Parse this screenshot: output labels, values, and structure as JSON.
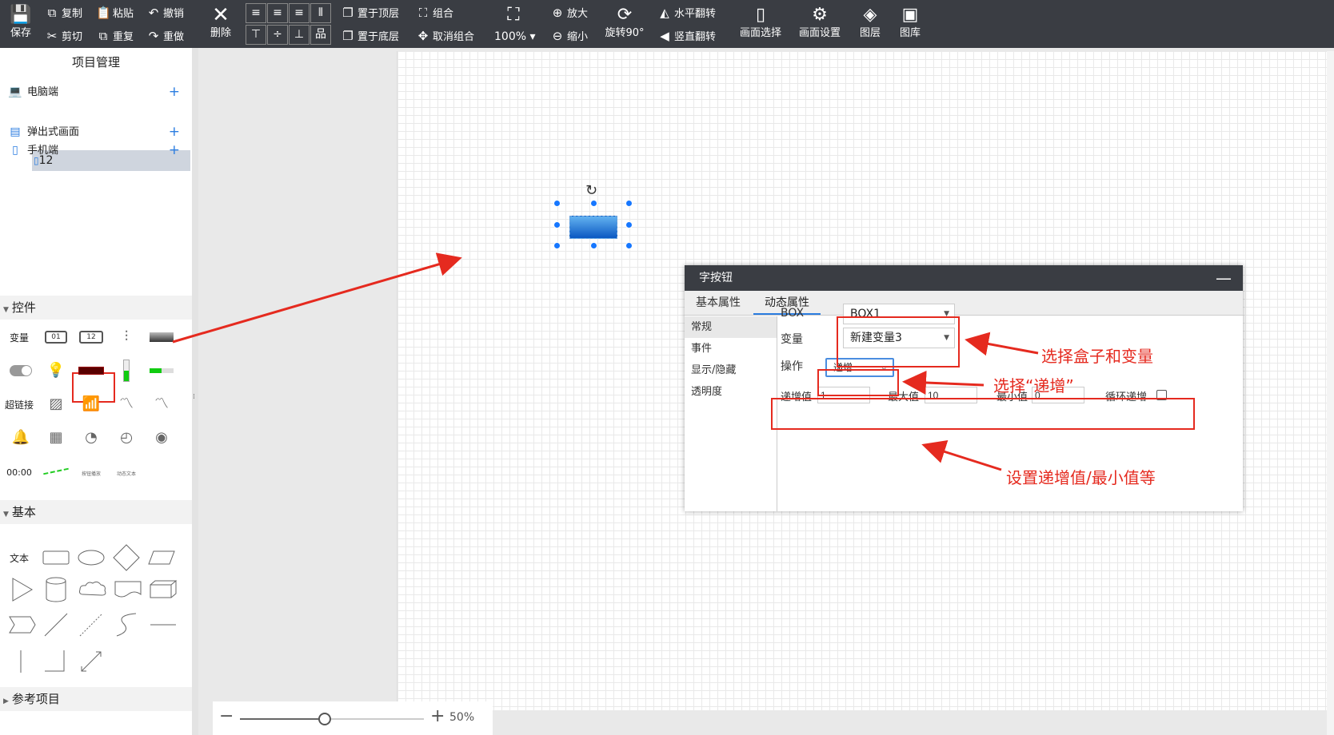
{
  "toolbar": {
    "save": "保存",
    "copy": "复制",
    "paste": "粘贴",
    "undo": "撤销",
    "cut": "剪切",
    "repeat": "重复",
    "redo": "重做",
    "delete": "删除",
    "bring_top": "置于顶层",
    "send_bottom": "置于底层",
    "group": "组合",
    "ungroup": "取消组合",
    "zoom_level": "100%",
    "zoom_in": "放大",
    "zoom_out": "缩小",
    "rotate": "旋转90°",
    "flip_h": "水平翻转",
    "flip_v": "竖直翻转",
    "screen_select": "画面选择",
    "screen_settings": "画面设置",
    "layers": "图层",
    "gallery": "图库"
  },
  "left_panel": {
    "title": "项目管理",
    "tree": [
      {
        "label": "电脑端",
        "icon": "laptop-icon"
      },
      {
        "label": "12",
        "icon": "file-icon"
      },
      {
        "label": "弹出式画面",
        "icon": "popup-icon"
      },
      {
        "label": "手机端",
        "icon": "phone-icon"
      }
    ],
    "section_controls": "控件",
    "controls": {
      "variable": "变量",
      "hyperlink": "超链接",
      "time": "00:00",
      "t1": "按钮播放",
      "t2": "动态文本",
      "num01": "01",
      "num12": "12"
    },
    "section_basic": "基本",
    "basic_text": "文本",
    "section_reference": "参考项目"
  },
  "zoom": {
    "value": "50%",
    "fraction": 0.46
  },
  "dialog": {
    "title": "字按钮",
    "tabs": [
      "基本属性",
      "动态属性"
    ],
    "active_tab": 1,
    "left_items": [
      "常规",
      "事件",
      "显示/隐藏",
      "透明度"
    ],
    "box_label": "BOX",
    "box_value": "BOX1",
    "var_label": "变量",
    "var_value": "新建变量3",
    "op_label": "操作",
    "op_value": "递增",
    "inc_label": "递增值",
    "inc_value": "1",
    "max_label": "最大值",
    "max_value": "10",
    "min_label": "最小值",
    "min_value": "0",
    "loop_label": "循环递增",
    "loop_checked": false
  },
  "annotations": {
    "box_var": "选择盒子和变量",
    "op": "选择“递增”",
    "values": "设置递增值/最小值等"
  },
  "colors": {
    "toolbar_bg": "#3a3d43",
    "accent": "#2b7de0",
    "annotation": "#e52a1f"
  }
}
